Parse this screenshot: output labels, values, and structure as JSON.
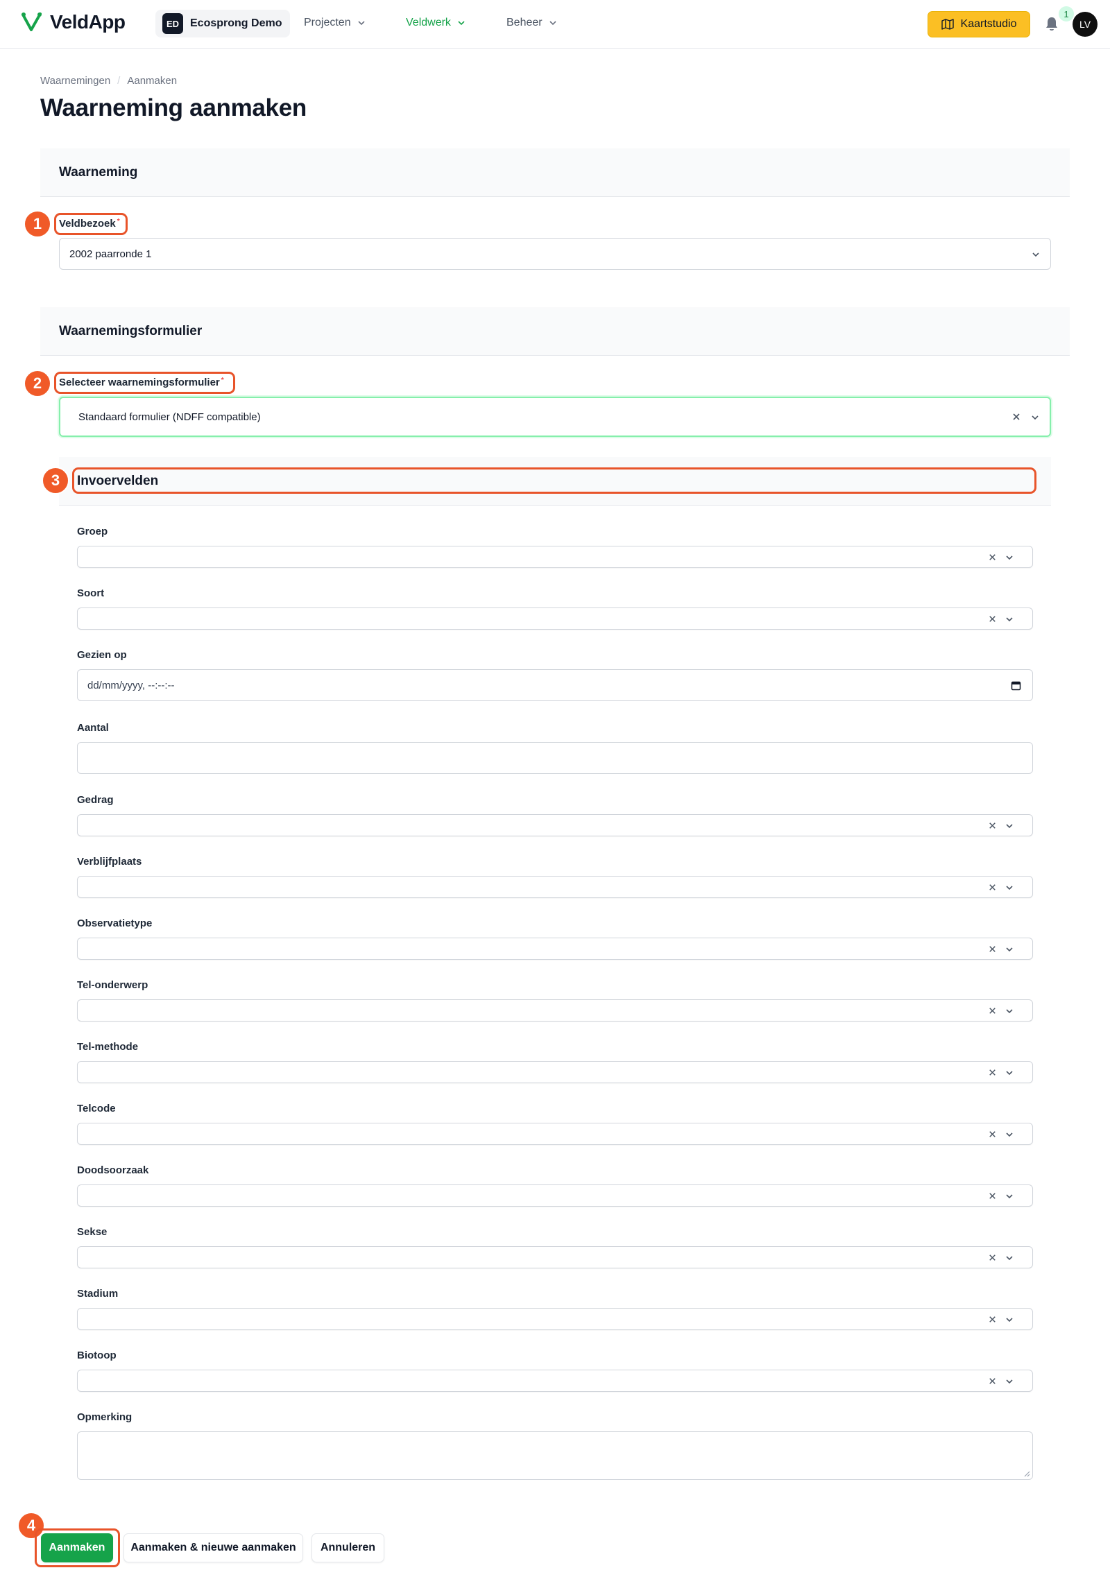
{
  "header": {
    "app_name": "VeldApp",
    "tenant_initials": "ED",
    "tenant_name": "Ecosprong Demo",
    "nav": [
      {
        "label": "Projecten"
      },
      {
        "label": "Veldwerk"
      },
      {
        "label": "Beheer"
      }
    ],
    "map_studio_label": "Kaartstudio",
    "notification_count": "1",
    "user_initials": "LV"
  },
  "breadcrumb": [
    "Waarnemingen",
    "Aanmaken"
  ],
  "page_title": "Waarneming aanmaken",
  "section_observation": {
    "title": "Waarneming",
    "field_label": "Veldbezoek",
    "required": "*",
    "value": "2002 paarronde 1"
  },
  "section_form": {
    "title": "Waarnemingsformulier",
    "field_label": "Selecteer waarnemingsformulier",
    "required": "*",
    "value": "Standaard formulier (NDFF compatible)"
  },
  "section_fields": {
    "title": "Invoervelden",
    "groep": "Groep",
    "soort": "Soort",
    "gezien_op": "Gezien op",
    "gezien_op_placeholder": "dd/mm/yyyy, --:--:--",
    "aantal": "Aantal",
    "gedrag": "Gedrag",
    "verblijfplaats": "Verblijfplaats",
    "observatietype": "Observatietype",
    "tel_onderwerp": "Tel-onderwerp",
    "tel_methode": "Tel-methode",
    "telcode": "Telcode",
    "doodsoorzaak": "Doodsoorzaak",
    "sekse": "Sekse",
    "stadium": "Stadium",
    "biotoop": "Biotoop",
    "opmerking": "Opmerking"
  },
  "markers": [
    "1",
    "2",
    "3",
    "4"
  ],
  "actions": {
    "create": "Aanmaken",
    "create_and_new": "Aanmaken & nieuwe aanmaken",
    "cancel": "Annuleren"
  },
  "colors": {
    "brand_green": "#16a34a",
    "accent_yellow": "#fbbf24",
    "annotation_orange": "#f05a28"
  }
}
